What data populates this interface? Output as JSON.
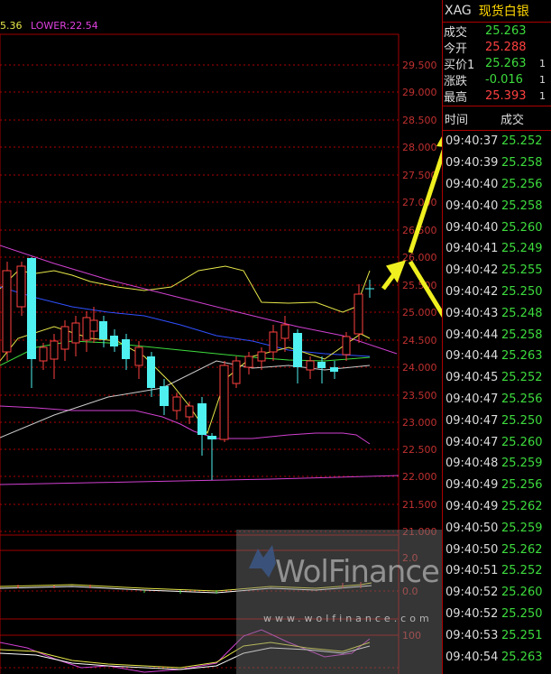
{
  "legend": {
    "mid": "5.36",
    "lower": "LOWER:22.54"
  },
  "price_axis": [
    "29.500",
    "29.000",
    "28.500",
    "28.000",
    "27.500",
    "27.000",
    "26.500",
    "26.000",
    "25.500",
    "25.000",
    "24.500",
    "24.000",
    "23.500",
    "23.000",
    "22.500",
    "22.000",
    "21.500",
    "21.000"
  ],
  "macd_axis": [
    "2.0",
    "0.0"
  ],
  "kdj_axis": [
    "100"
  ],
  "symbol": {
    "code": "XAG",
    "name": "现货白银"
  },
  "quote": [
    {
      "label": "成交",
      "value": "25.263",
      "color": "green"
    },
    {
      "label": "今开",
      "value": "25.288",
      "color": "red"
    },
    {
      "label": "买价1",
      "value": "25.263",
      "color": "green",
      "extra": "1"
    },
    {
      "label": "涨跌",
      "value": "-0.016",
      "color": "green",
      "extra": "1"
    },
    {
      "label": "最高",
      "value": "25.393",
      "color": "red",
      "extra": "1"
    }
  ],
  "trades_header": {
    "time": "时间",
    "price": "成交"
  },
  "trades": [
    {
      "time": "09:40:37",
      "price": "25.252"
    },
    {
      "time": "09:40:39",
      "price": "25.258"
    },
    {
      "time": "09:40:40",
      "price": "25.256"
    },
    {
      "time": "09:40:40",
      "price": "25.258"
    },
    {
      "time": "09:40:40",
      "price": "25.260"
    },
    {
      "time": "09:40:41",
      "price": "25.249"
    },
    {
      "time": "09:40:42",
      "price": "25.255"
    },
    {
      "time": "09:40:42",
      "price": "25.250"
    },
    {
      "time": "09:40:43",
      "price": "25.248"
    },
    {
      "time": "09:40:44",
      "price": "25.258"
    },
    {
      "time": "09:40:44",
      "price": "25.263"
    },
    {
      "time": "09:40:45",
      "price": "25.252"
    },
    {
      "time": "09:40:47",
      "price": "25.256"
    },
    {
      "time": "09:40:47",
      "price": "25.250"
    },
    {
      "time": "09:40:47",
      "price": "25.260"
    },
    {
      "time": "09:40:48",
      "price": "25.259"
    },
    {
      "time": "09:40:49",
      "price": "25.256"
    },
    {
      "time": "09:40:49",
      "price": "25.262"
    },
    {
      "time": "09:40:50",
      "price": "25.259"
    },
    {
      "time": "09:40:50",
      "price": "25.262"
    },
    {
      "time": "09:40:51",
      "price": "25.252"
    },
    {
      "time": "09:40:52",
      "price": "25.260"
    },
    {
      "time": "09:40:52",
      "price": "25.250"
    },
    {
      "time": "09:40:53",
      "price": "25.251"
    },
    {
      "time": "09:40:54",
      "price": "25.263"
    }
  ],
  "watermark": {
    "brand": "WolFinance",
    "url": "www.wolfinance.com"
  },
  "colors": {
    "up": "#ff4040",
    "down": "#3ddc3d",
    "grid": "#a00000",
    "cyan": "#4ff0f0"
  }
}
